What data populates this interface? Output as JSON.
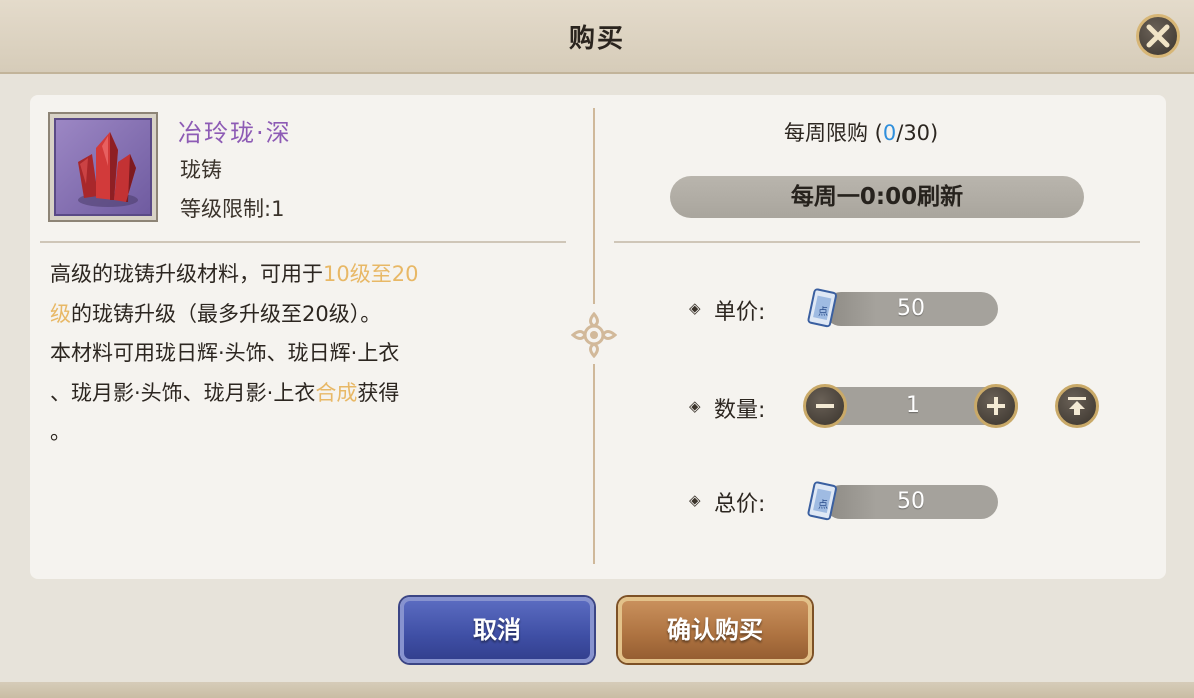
{
  "dialog": {
    "title": "购买"
  },
  "item": {
    "name": "冶玲珑·深",
    "type": "珑铸",
    "level_limit": "等级限制:1",
    "description": [
      {
        "parts": [
          {
            "t": "高级的珑铸升级材料，可用于"
          },
          {
            "t": "10级至20",
            "hl": true
          }
        ]
      },
      {
        "parts": [
          {
            "t": "级",
            "hl": true
          },
          {
            "t": "的珑铸升级（最多升级至20级）。"
          }
        ]
      },
      {
        "parts": [
          {
            "t": "本材料可用珑日辉·头饰、珑日辉·上衣"
          }
        ]
      },
      {
        "parts": [
          {
            "t": "、珑月影·头饰、珑月影·上衣"
          },
          {
            "t": "合成",
            "hl": true
          },
          {
            "t": "获得"
          }
        ]
      },
      {
        "parts": [
          {
            "t": "。"
          }
        ]
      }
    ]
  },
  "purchase": {
    "weekly_label": "每周限购 (",
    "weekly_current": "0",
    "weekly_sep_max": "/30)",
    "refresh_text": "每周一0:00刷新",
    "unit_price_label": "单价:",
    "unit_price": "50",
    "quantity_label": "数量:",
    "quantity": "1",
    "total_label": "总价:",
    "total_price": "50",
    "currency_icon": "coupon-ticket-icon"
  },
  "buttons": {
    "cancel": "取消",
    "confirm": "确认购买"
  },
  "colors": {
    "highlight": "#e8b866",
    "item_name": "#8d5bb5",
    "weekly_current": "#2f8fdc"
  }
}
